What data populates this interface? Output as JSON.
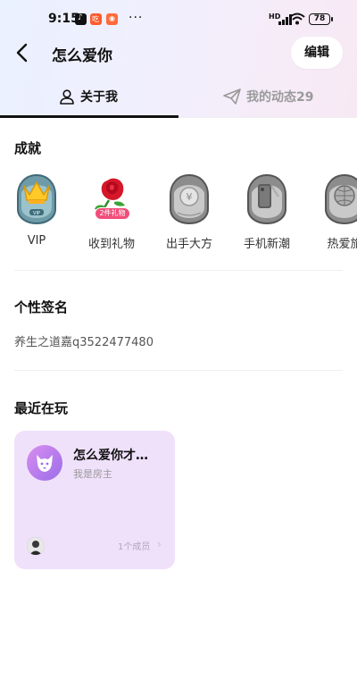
{
  "status_bar": {
    "time": "9:15",
    "dots": "···",
    "network": "HD",
    "battery": "78"
  },
  "header": {
    "title": "怎么爱你",
    "edit_label": "编辑"
  },
  "tabs": [
    {
      "label": "关于我",
      "icon": "user-icon",
      "active": true
    },
    {
      "label": "我的动态29",
      "icon": "paper-plane-icon",
      "active": false
    }
  ],
  "achievements": {
    "title": "成就",
    "items": [
      {
        "label": "VIP",
        "icon": "vip-crown-badge"
      },
      {
        "label": "收到礼物",
        "icon": "rose-gift-badge",
        "tag": "2件礼物"
      },
      {
        "label": "出手大方",
        "icon": "coin-badge"
      },
      {
        "label": "手机新潮",
        "icon": "phone-badge"
      },
      {
        "label": "热爱旅",
        "icon": "globe-badge"
      }
    ]
  },
  "signature": {
    "title": "个性签名",
    "text": "养生之道嘉q3522477480"
  },
  "recent": {
    "title": "最近在玩",
    "card": {
      "name": "怎么爱你才…",
      "role": "我是房主",
      "members": "1个成员"
    }
  },
  "colors": {
    "accent_purple": "#f0e1fb",
    "rose_tag": "#f24d7a"
  }
}
